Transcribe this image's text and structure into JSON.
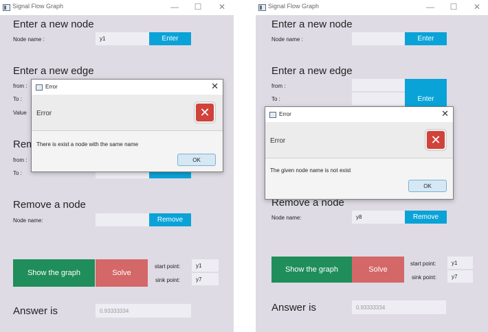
{
  "window_title": "Signal Flow Graph",
  "controls": {
    "minimize": "—",
    "maximize": "☐",
    "close": "✕"
  },
  "sections": {
    "new_node": "Enter a new node",
    "new_edge": "Enter a new edge",
    "remove_edge_left": "Rem",
    "remove_node": "Remove a node",
    "answer": "Answer is"
  },
  "labels": {
    "node_name": "Node name :",
    "from_short": "from :",
    "to": "To :",
    "value_short": "Value",
    "to_lower": "To :",
    "node_name2": "Node name:",
    "start_point": "start point:",
    "sink_point": "sink point:"
  },
  "buttons": {
    "enter": "Enter",
    "remove": "Remove",
    "show_graph": "Show the graph",
    "solve": "Solve",
    "ok": "OK"
  },
  "left": {
    "node_value": "y1",
    "remove_node_value": "",
    "start_value": "y1",
    "sink_value": "y7",
    "answer_value": "0.93333334",
    "dialog": {
      "title": "Error",
      "header": "Error",
      "message": "There is exist a node with the same name"
    }
  },
  "right": {
    "node_value": "",
    "remove_node_value": "y8",
    "start_value": "y1",
    "sink_value": "y7",
    "answer_value": "0.93333334",
    "dialog": {
      "title": "Error",
      "header": "Error",
      "message": "The given node name is not exist"
    }
  },
  "colors": {
    "window_bg": "#dedbe5",
    "accent_blue": "#0aa3d8",
    "green": "#1f8e5a",
    "red": "#d46767",
    "error_icon": "#d0423a"
  }
}
